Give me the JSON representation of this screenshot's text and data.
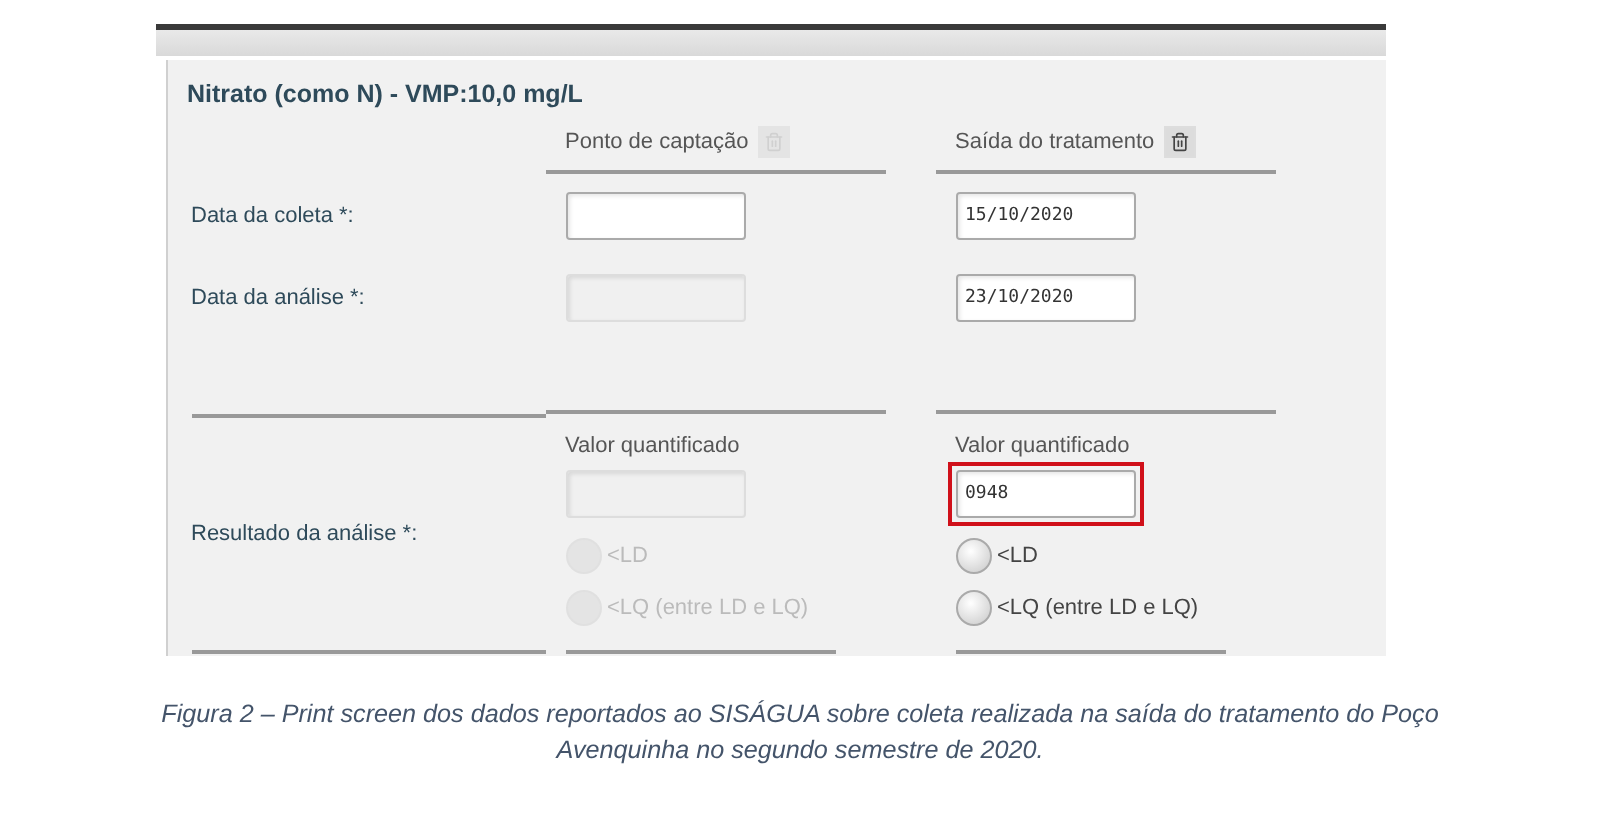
{
  "panel": {
    "title": "Nitrato (como N) - VMP:10,0 mg/L",
    "row_labels": {
      "collection_date": "Data da coleta *:",
      "analysis_date": "Data da análise *:",
      "result": "Resultado da análise *:"
    },
    "columns": [
      {
        "header": "Ponto de captação",
        "disabled": true,
        "collection_date": {
          "disabled": false
        },
        "analysis_date": {
          "disabled": true
        },
        "value_label": "Valor quantificado",
        "value_field": {
          "disabled": true,
          "highlighted": false
        },
        "options": [
          {
            "label": "<LD",
            "selected": false
          },
          {
            "label": "<LQ (entre LD e LQ)",
            "selected": false
          }
        ]
      },
      {
        "header": "Saída do tratamento",
        "disabled": false,
        "collection_date": {
          "value": "15/10/2020",
          "disabled": false
        },
        "analysis_date": {
          "value": "23/10/2020",
          "disabled": false
        },
        "value_label": "Valor quantificado",
        "value_field": {
          "value": "0948",
          "disabled": false,
          "highlighted": true
        },
        "options": [
          {
            "label": "<LD",
            "selected": false
          },
          {
            "label": "<LQ (entre LD e LQ)",
            "selected": false
          }
        ]
      }
    ]
  },
  "caption": "Figura 2 – Print screen dos dados reportados ao SISÁGUA sobre coleta realizada na saída do tratamento do Poço Avenquinha no segundo semestre de 2020."
}
